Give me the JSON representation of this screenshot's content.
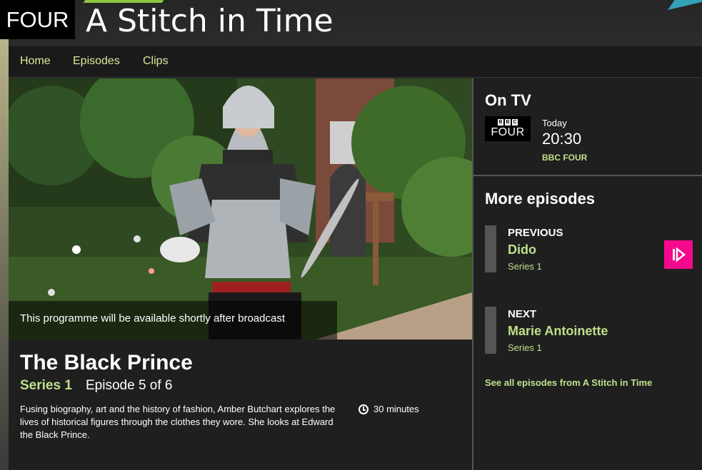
{
  "header": {
    "channel_logo": "FOUR",
    "title": "A Stitch in Time"
  },
  "nav": {
    "items": [
      "Home",
      "Episodes",
      "Clips"
    ]
  },
  "hero": {
    "availability_text": "This programme will be available shortly after broadcast"
  },
  "episode": {
    "title": "The Black Prince",
    "series": "Series 1",
    "episode_number": "Episode 5 of 6",
    "synopsis": "Fusing biography, art and the history of fashion, Amber Butchart explores the lives of historical figures through the clothes they wore. She looks at Edward the Black Prince.",
    "duration": "30 minutes"
  },
  "on_tv": {
    "heading": "On TV",
    "logo_top": [
      "B",
      "B",
      "C"
    ],
    "logo_bottom": "FOUR",
    "day": "Today",
    "time": "20:30",
    "channel": "BBC FOUR"
  },
  "more_episodes": {
    "heading": "More episodes",
    "previous": {
      "label": "PREVIOUS",
      "name": "Dido",
      "series": "Series 1"
    },
    "next": {
      "label": "NEXT",
      "name": "Marie Antoinette",
      "series": "Series 1"
    },
    "see_all": "See all episodes from A Stitch in Time"
  },
  "colors": {
    "accent_green": "#bfe08a",
    "iplayer_pink": "#f5098c",
    "background": "#1f1f1f"
  }
}
